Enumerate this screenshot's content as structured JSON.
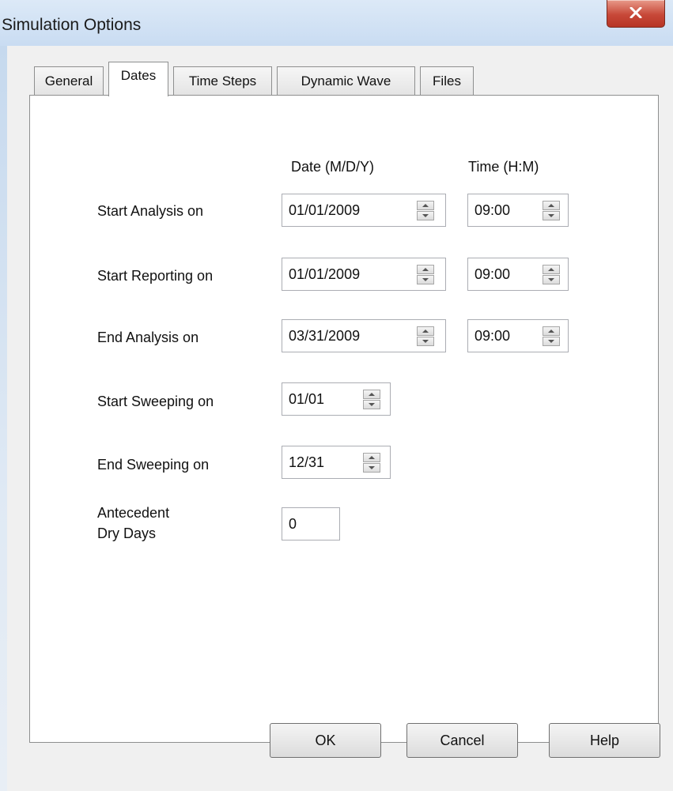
{
  "window": {
    "title": "Simulation Options"
  },
  "tabs": [
    {
      "label": "General",
      "active": false
    },
    {
      "label": "Dates",
      "active": true
    },
    {
      "label": "Time Steps",
      "active": false
    },
    {
      "label": "Dynamic Wave",
      "active": false
    },
    {
      "label": "Files",
      "active": false
    }
  ],
  "headers": {
    "date": "Date (M/D/Y)",
    "time": "Time (H:M)"
  },
  "rows": {
    "start_analysis": {
      "label": "Start Analysis on",
      "date": "01/01/2009",
      "time": "09:00"
    },
    "start_reporting": {
      "label": "Start Reporting on",
      "date": "01/01/2009",
      "time": "09:00"
    },
    "end_analysis": {
      "label": "End Analysis on",
      "date": "03/31/2009",
      "time": "09:00"
    },
    "start_sweeping": {
      "label": "Start Sweeping on",
      "date": "01/01"
    },
    "end_sweeping": {
      "label": "End Sweeping on",
      "date": "12/31"
    },
    "antecedent": {
      "label_line1": "Antecedent",
      "label_line2": "Dry Days",
      "value": "0"
    }
  },
  "buttons": {
    "ok": "OK",
    "cancel": "Cancel",
    "help": "Help"
  },
  "colors": {
    "close_button": "#c74838",
    "titlebar": "#dce9f7"
  },
  "icons": {
    "close": "close-icon",
    "spin": "spin-updown-icon"
  }
}
